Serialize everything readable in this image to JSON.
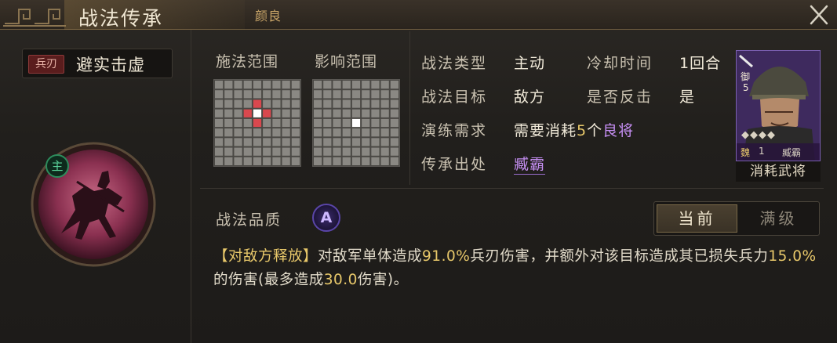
{
  "header": {
    "title": "战法传承",
    "subtitle": "颜良"
  },
  "skill": {
    "kind": "兵刃",
    "name": "避实击虚",
    "role_badge": "主"
  },
  "ranges": {
    "cast_label": "施法范围",
    "effect_label": "影响范围",
    "cast_cells": {
      "self": [
        4,
        3
      ],
      "targets": [
        [
          3,
          3
        ],
        [
          5,
          3
        ],
        [
          4,
          2
        ],
        [
          4,
          4
        ]
      ]
    },
    "effect_cells": {
      "self": [
        4,
        4
      ],
      "targets": []
    },
    "grid_size": 9
  },
  "info": {
    "type_label": "战法类型",
    "type_value": "主动",
    "cooldown_label": "冷却时间",
    "cooldown_value": "1回合",
    "target_label": "战法目标",
    "target_value": "敌方",
    "counter_label": "是否反击",
    "counter_value": "是",
    "practice_label": "演练需求",
    "practice_prefix": "需要消耗",
    "practice_count": "5",
    "practice_mid": "个",
    "practice_item": "良将",
    "source_label": "传承出处",
    "source_value": "臧霸"
  },
  "general_card": {
    "rank_glyph": "御",
    "cost": "5",
    "stars": "◆◆◆◆",
    "faction": "魏",
    "level": "1",
    "name": "臧霸",
    "caption": "消耗武将"
  },
  "quality": {
    "label": "战法品质",
    "grade": "A"
  },
  "toggle": {
    "current": "当前",
    "max": "满级"
  },
  "description": {
    "tag": "【对敌方释放】",
    "part1": "对敌军单体造成",
    "dmg1": "91.0%",
    "part2": "兵刃伤害，并额外对该目标造成其已损失兵力",
    "dmg2": "15.0%",
    "part3": "的伤害(最多造成",
    "dmg3": "30.0",
    "part4": "伤害)。"
  },
  "colors": {
    "accent_gold": "#e8c86a",
    "accent_purple": "#c58ef2",
    "range_target": "#d9484e",
    "range_self": "#ffffff"
  },
  "icons": {
    "close": "close-icon",
    "fret": "fret-ornament-icon",
    "emblem": "cavalry-emblem-icon"
  }
}
